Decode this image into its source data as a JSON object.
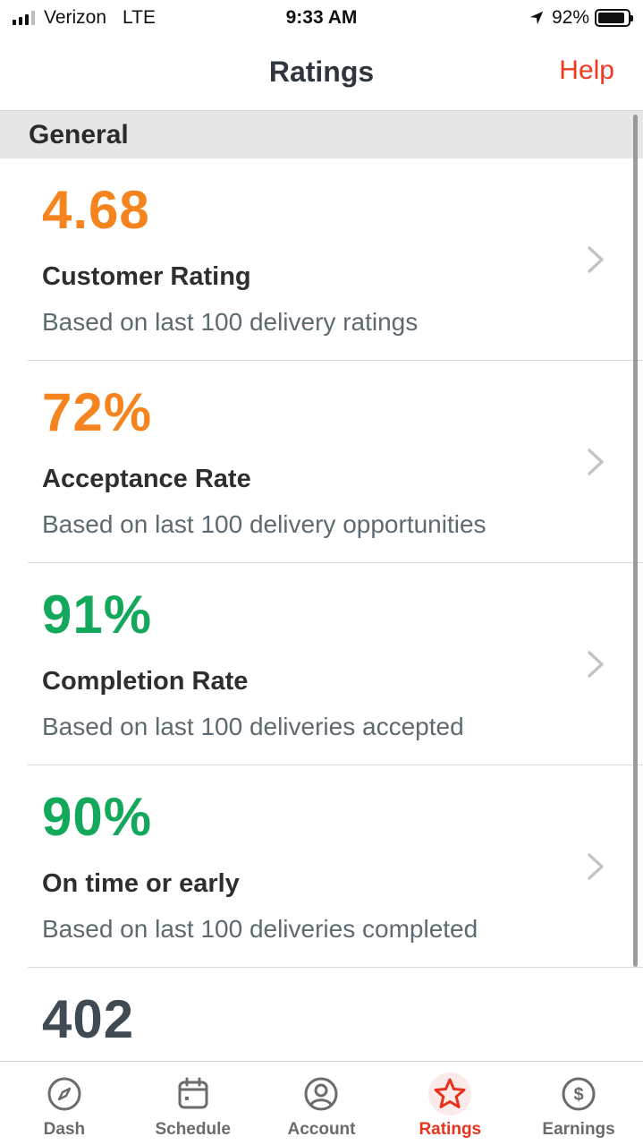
{
  "status_bar": {
    "carrier": "Verizon",
    "network": "LTE",
    "time": "9:33 AM",
    "battery": "92%",
    "battery_level": 0.92
  },
  "nav": {
    "title": "Ratings",
    "help_label": "Help",
    "accent_color": "#f0391f"
  },
  "section": {
    "title": "General"
  },
  "metrics": [
    {
      "value": "4.68",
      "title": "Customer Rating",
      "subtitle": "Based on last 100 delivery ratings",
      "color": "#f5841f"
    },
    {
      "value": "72%",
      "title": "Acceptance Rate",
      "subtitle": "Based on last 100 delivery opportunities",
      "color": "#f5841f"
    },
    {
      "value": "91%",
      "title": "Completion Rate",
      "subtitle": "Based on last 100 deliveries accepted",
      "color": "#13a85b"
    },
    {
      "value": "90%",
      "title": "On time or early",
      "subtitle": "Based on last 100 deliveries completed",
      "color": "#13a85b"
    },
    {
      "value": "402"
    }
  ],
  "tabs": [
    {
      "label": "Dash",
      "icon": "compass-icon"
    },
    {
      "label": "Schedule",
      "icon": "calendar-icon"
    },
    {
      "label": "Account",
      "icon": "user-circle-icon"
    },
    {
      "label": "Ratings",
      "icon": "star-icon",
      "active": true
    },
    {
      "label": "Earnings",
      "icon": "dollar-circle-icon"
    }
  ],
  "colors": {
    "active_tab": "#e8321c",
    "inactive_tab": "#6b6b6b"
  }
}
